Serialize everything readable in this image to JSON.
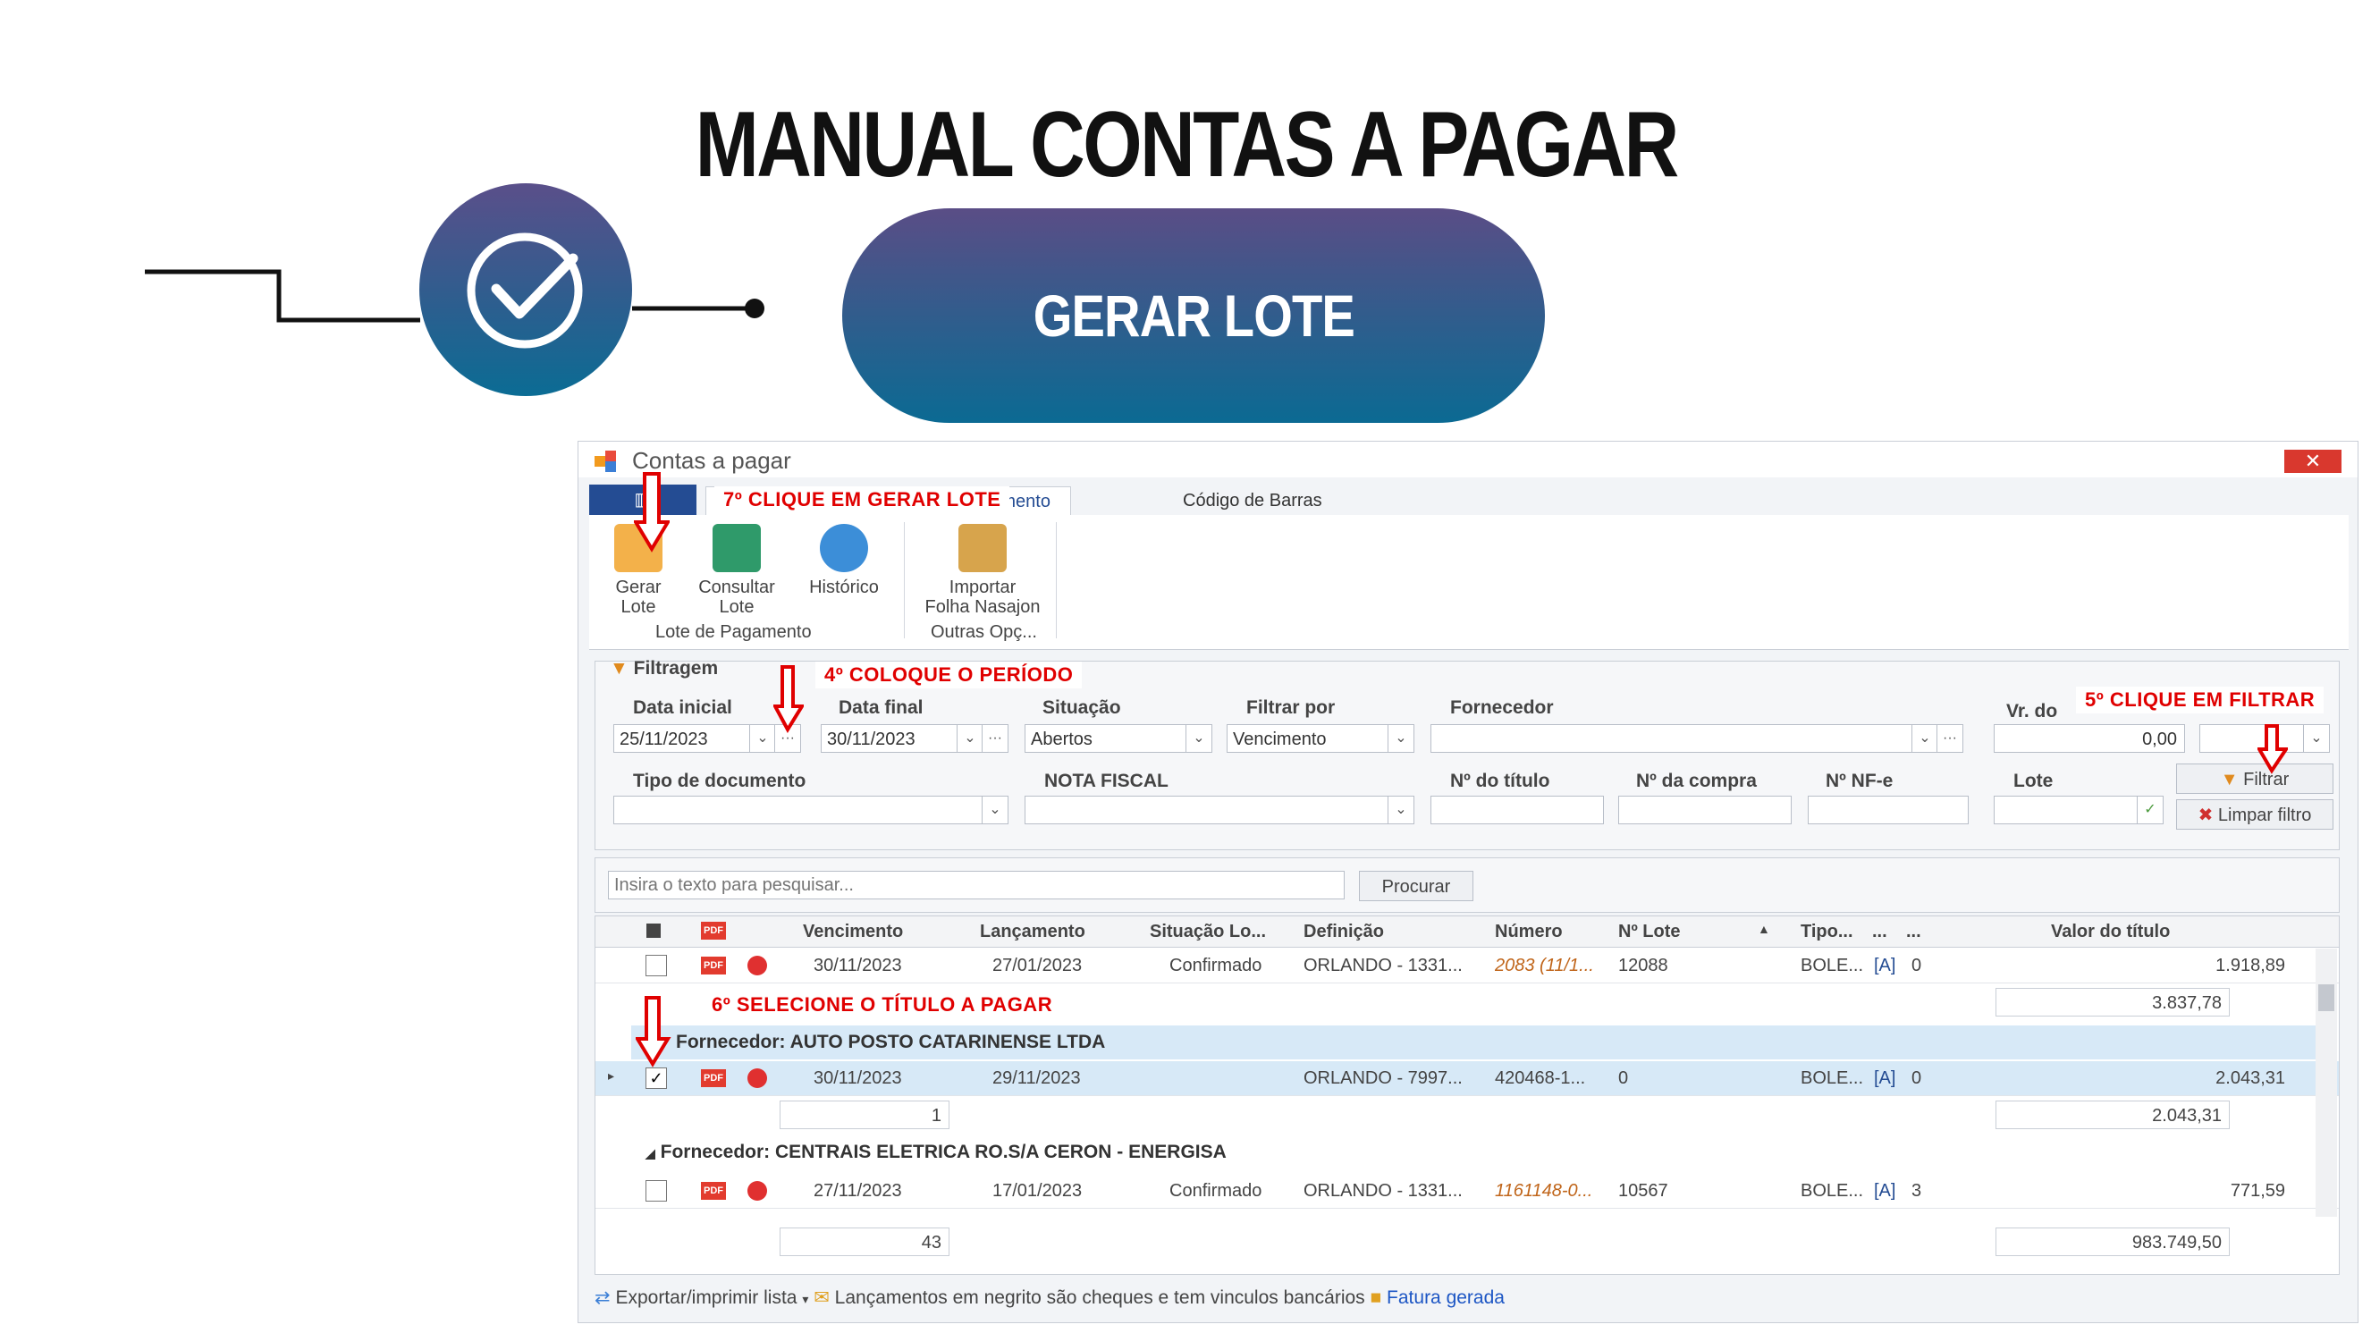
{
  "header": {
    "title": "MANUAL CONTAS A PAGAR",
    "section": "GERAR LOTE"
  },
  "window": {
    "title": "Contas a pagar",
    "close": "✕",
    "tabs": [
      "7º CLIQUE EM GERAR LOTE",
      "...gamento",
      "Código de Barras"
    ],
    "ribbon": {
      "buttons": [
        {
          "label1": "Gerar",
          "label2": "Lote"
        },
        {
          "label1": "Consultar",
          "label2": "Lote"
        },
        {
          "label1": "Histórico",
          "label2": ""
        },
        {
          "label1": "Importar",
          "label2": "Folha Nasajon"
        }
      ],
      "groups": [
        "Lote de Pagamento",
        "Outras Opç..."
      ]
    },
    "callouts": {
      "step7": "7º CLIQUE EM GERAR LOTE",
      "step4": "4º COLOQUE O PERÍODO",
      "step5": "5º CLIQUE EM FILTRAR",
      "step6": "6º SELECIONE O TÍTULO A PAGAR"
    },
    "filter": {
      "title": "Filtragem",
      "data_inicial_label": "Data inicial",
      "data_inicial": "25/11/2023",
      "data_final_label": "Data final",
      "data_final": "30/11/2023",
      "situacao_label": "Situação",
      "situacao": "Abertos",
      "filtrar_por_label": "Filtrar por",
      "filtrar_por": "Vencimento",
      "fornecedor_label": "Fornecedor",
      "vr_label": "Vr. do",
      "vr_value": "0,00",
      "tipo_doc_label": "Tipo de documento",
      "nota_fiscal_label": "NOTA FISCAL",
      "num_titulo_label": "Nº do título",
      "num_compra_label": "Nº da compra",
      "num_nfe_label": "Nº NF-e",
      "lote_label": "Lote",
      "filtrar_btn": "Filtrar",
      "limpar_btn": "Limpar filtro",
      "ellipsis": "···"
    },
    "search": {
      "placeholder": "Insira o texto para pesquisar...",
      "button": "Procurar"
    },
    "grid": {
      "columns": [
        "Vencimento",
        "Lançamento",
        "Situação Lo...",
        "Definição",
        "Número",
        "Nº Lote",
        "Tipo...",
        "...",
        "...",
        "Valor do título"
      ],
      "row1": {
        "venc": "30/11/2023",
        "lanc": "27/01/2023",
        "sit": "Confirmado",
        "def": "ORLANDO - 1331...",
        "num": "2083 (11/1...",
        "lote": "12088",
        "tipo": "BOLE...",
        "c": "0",
        "valor": "1.918,89"
      },
      "subtotal1": "3.837,78",
      "group2": "Fornecedor: AUTO POSTO CATARINENSE LTDA",
      "row2": {
        "venc": "30/11/2023",
        "lanc": "29/11/2023",
        "sit": "",
        "def": "ORLANDO - 7997...",
        "num": "420468-1...",
        "lote": "0",
        "tipo": "BOLE...",
        "c": "0",
        "valor": "2.043,31"
      },
      "count2": "1",
      "subtotal2": "2.043,31",
      "group3": "Fornecedor: CENTRAIS ELETRICA RO.S/A CERON - ENERGISA",
      "row3": {
        "venc": "27/11/2023",
        "lanc": "17/01/2023",
        "sit": "Confirmado",
        "def": "ORLANDO - 1331...",
        "num": "1161148-0...",
        "lote": "10567",
        "tipo": "BOLE...",
        "c": "3",
        "valor": "771,59"
      },
      "total_count": "43",
      "total_value": "983.749,50"
    },
    "status": {
      "export": "Exportar/imprimir lista",
      "note": "Lançamentos em negrito são cheques e tem vinculos bancários",
      "fatura": "Fatura gerada"
    }
  },
  "colors": {
    "brand_dark": "#244c93",
    "accent_red": "#e00000",
    "pill": "#0b6a93"
  }
}
